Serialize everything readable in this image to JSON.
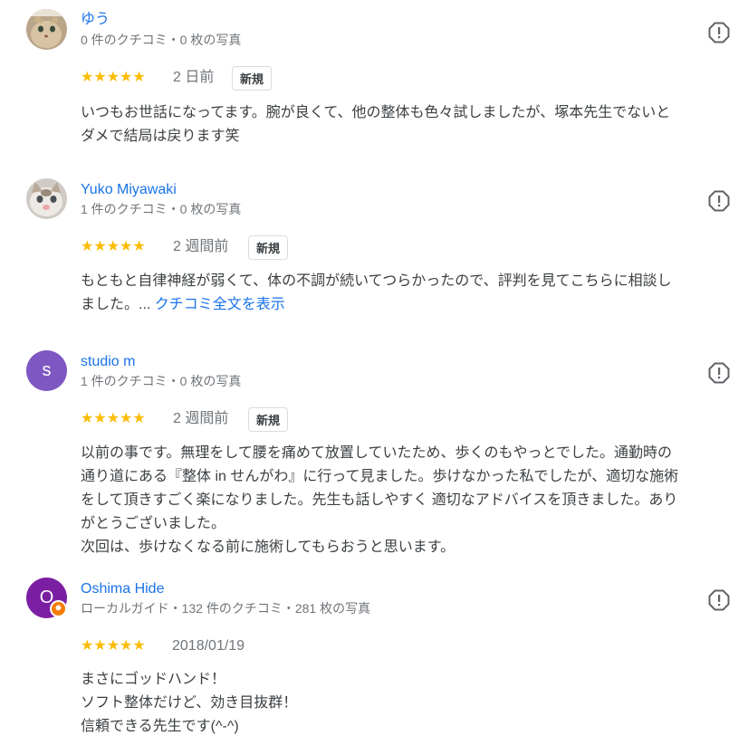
{
  "colors": {
    "link": "#1a73e8",
    "meta": "#70757a",
    "star": "#fbbc04",
    "avatar_studio_m": "#7e57c2",
    "avatar_oshima": "#7b1fa2",
    "local_guide_badge": "#f57c00"
  },
  "reviews": [
    {
      "name": "ゆう",
      "meta": "0 件のクチコミ・0 枚の写真",
      "avatar": "cat-photo",
      "stars": "★★★★★",
      "date": "2 日前",
      "new_label": "新規",
      "text": "いつもお世話になってます。腕が良くて、他の整体も色々試しましたが、塚本先生でないと\nダメで結局は戻ります笑",
      "flag_icon": "report-flag-icon"
    },
    {
      "name": "Yuko Miyawaki",
      "meta": "1 件のクチコミ・0 枚の写真",
      "avatar": "kitten-photo",
      "stars": "★★★★★",
      "date": "2 週間前",
      "new_label": "新規",
      "text": "もともと自律神経が弱くて、体の不調が続いてつらかったので、評判を見てこちらに相談し\nました。... ",
      "more": "クチコミ全文を表示",
      "flag_icon": "report-flag-icon"
    },
    {
      "name": "studio m",
      "meta": "1 件のクチコミ・0 枚の写真",
      "avatar_letter": "s",
      "stars": "★★★★★",
      "date": "2 週間前",
      "new_label": "新規",
      "text": "以前の事です。無理をして腰を痛めて放置していたため、歩くのもやっとでした。通勤時の\n通り道にある『整体 in せんがわ』に行って見ました。歩けなかった私でしたが、適切な施術\nをして頂きすごく楽になりました。先生も話しやすく 適切なアドバイスを頂きました。あり\nがとうございました。\n次回は、歩けなくなる前に施術してもらおうと思います。",
      "flag_icon": "report-flag-icon"
    },
    {
      "name": "Oshima Hide",
      "meta": "ローカルガイド・132 件のクチコミ・281 枚の写真",
      "avatar_letter": "O",
      "badge_icon": "local-guide-star-icon",
      "stars": "★★★★★",
      "date": "2018/01/19",
      "text": "まさにゴッドハンド！\nソフト整体だけど、効き目抜群！\n信頼できる先生です(^-^)",
      "flag_icon": "report-flag-icon"
    }
  ]
}
